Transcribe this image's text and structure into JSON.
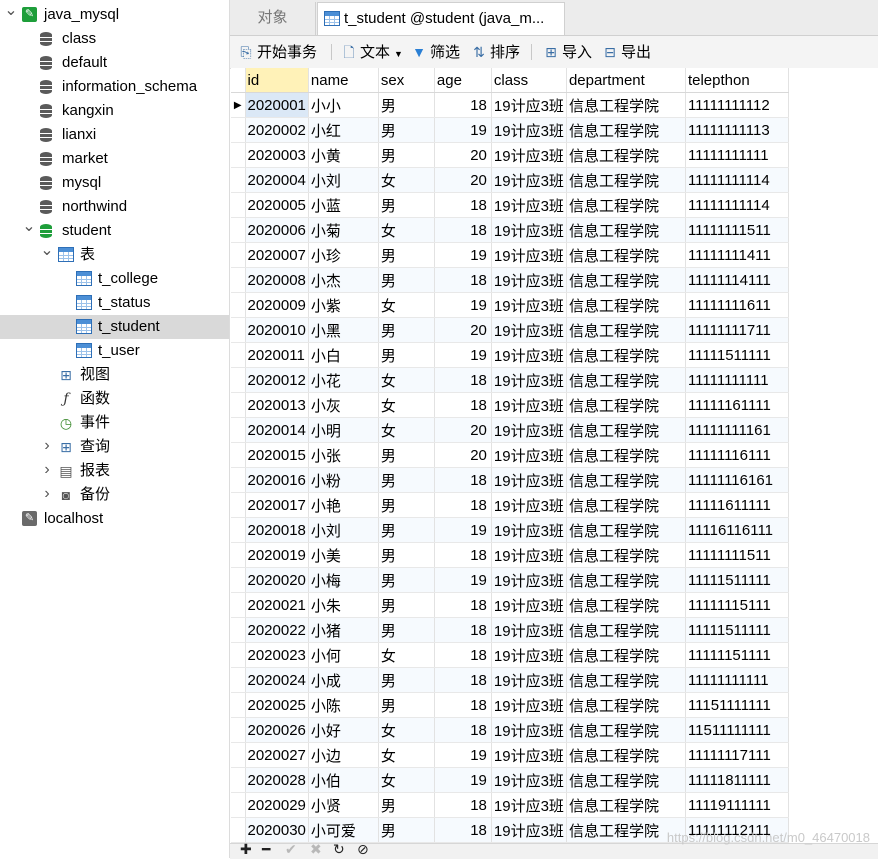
{
  "tree": {
    "items": [
      {
        "label": "java_mysql",
        "icon": "connection-icon",
        "arrow": "expanded",
        "level": 0,
        "selected": false
      },
      {
        "label": "class",
        "icon": "database-icon",
        "arrow": "",
        "level": 1,
        "selected": false
      },
      {
        "label": "default",
        "icon": "database-icon",
        "arrow": "",
        "level": 1,
        "selected": false
      },
      {
        "label": "information_schema",
        "icon": "database-icon",
        "arrow": "",
        "level": 1,
        "selected": false
      },
      {
        "label": "kangxin",
        "icon": "database-icon",
        "arrow": "",
        "level": 1,
        "selected": false
      },
      {
        "label": "lianxi",
        "icon": "database-icon",
        "arrow": "",
        "level": 1,
        "selected": false
      },
      {
        "label": "market",
        "icon": "database-icon",
        "arrow": "",
        "level": 1,
        "selected": false
      },
      {
        "label": "mysql",
        "icon": "database-icon",
        "arrow": "",
        "level": 1,
        "selected": false
      },
      {
        "label": "northwind",
        "icon": "database-icon",
        "arrow": "",
        "level": 1,
        "selected": false
      },
      {
        "label": "student",
        "icon": "database-open-icon",
        "arrow": "expanded",
        "level": 1,
        "selected": false
      },
      {
        "label": "表",
        "icon": "tables-folder-icon",
        "arrow": "expanded",
        "level": 2,
        "selected": false
      },
      {
        "label": "t_college",
        "icon": "table-icon",
        "arrow": "",
        "level": 3,
        "selected": false
      },
      {
        "label": "t_status",
        "icon": "table-icon",
        "arrow": "",
        "level": 3,
        "selected": false
      },
      {
        "label": "t_student",
        "icon": "table-icon",
        "arrow": "",
        "level": 3,
        "selected": true
      },
      {
        "label": "t_user",
        "icon": "table-icon",
        "arrow": "",
        "level": 3,
        "selected": false
      },
      {
        "label": "视图",
        "icon": "view-icon",
        "arrow": "",
        "level": 2,
        "selected": false
      },
      {
        "label": "函数",
        "icon": "function-icon",
        "arrow": "",
        "level": 2,
        "selected": false
      },
      {
        "label": "事件",
        "icon": "event-icon",
        "arrow": "",
        "level": 2,
        "selected": false
      },
      {
        "label": "查询",
        "icon": "query-icon",
        "arrow": "collapsed",
        "level": 2,
        "selected": false
      },
      {
        "label": "报表",
        "icon": "report-icon",
        "arrow": "collapsed",
        "level": 2,
        "selected": false
      },
      {
        "label": "备份",
        "icon": "backup-icon",
        "arrow": "collapsed",
        "level": 2,
        "selected": false
      },
      {
        "label": "localhost",
        "icon": "connection-grey-icon",
        "arrow": "",
        "level": 0,
        "selected": false
      }
    ]
  },
  "tabs": {
    "objects": "对象",
    "active": "t_student @student (java_m..."
  },
  "toolbar": {
    "begin_transaction": "开始事务",
    "text": "文本",
    "filter": "筛选",
    "sort": "排序",
    "import": "导入",
    "export": "导出"
  },
  "grid": {
    "columns": [
      "id",
      "name",
      "sex",
      "age",
      "class",
      "department",
      "telepthon"
    ],
    "rows": [
      [
        "2020001",
        "小小",
        "男",
        "18",
        "19计应3班",
        "信息工程学院",
        "11111111112"
      ],
      [
        "2020002",
        "小红",
        "男",
        "19",
        "19计应3班",
        "信息工程学院",
        "11111111113"
      ],
      [
        "2020003",
        "小黄",
        "男",
        "20",
        "19计应3班",
        "信息工程学院",
        "11111111111"
      ],
      [
        "2020004",
        "小刘",
        "女",
        "20",
        "19计应3班",
        "信息工程学院",
        "11111111114"
      ],
      [
        "2020005",
        "小蓝",
        "男",
        "18",
        "19计应3班",
        "信息工程学院",
        "11111111114"
      ],
      [
        "2020006",
        "小菊",
        "女",
        "18",
        "19计应3班",
        "信息工程学院",
        "11111111511"
      ],
      [
        "2020007",
        "小珍",
        "男",
        "19",
        "19计应3班",
        "信息工程学院",
        "11111111411"
      ],
      [
        "2020008",
        "小杰",
        "男",
        "18",
        "19计应3班",
        "信息工程学院",
        "11111114111"
      ],
      [
        "2020009",
        "小紫",
        "女",
        "19",
        "19计应3班",
        "信息工程学院",
        "11111111611"
      ],
      [
        "2020010",
        "小黑",
        "男",
        "20",
        "19计应3班",
        "信息工程学院",
        "11111111711"
      ],
      [
        "2020011",
        "小白",
        "男",
        "19",
        "19计应3班",
        "信息工程学院",
        "11111511111"
      ],
      [
        "2020012",
        "小花",
        "女",
        "18",
        "19计应3班",
        "信息工程学院",
        "11111111111"
      ],
      [
        "2020013",
        "小灰",
        "女",
        "18",
        "19计应3班",
        "信息工程学院",
        "11111161111"
      ],
      [
        "2020014",
        "小明",
        "女",
        "20",
        "19计应3班",
        "信息工程学院",
        "11111111161"
      ],
      [
        "2020015",
        "小张",
        "男",
        "20",
        "19计应3班",
        "信息工程学院",
        "11111116111"
      ],
      [
        "2020016",
        "小粉",
        "男",
        "18",
        "19计应3班",
        "信息工程学院",
        "11111116161"
      ],
      [
        "2020017",
        "小艳",
        "男",
        "18",
        "19计应3班",
        "信息工程学院",
        "11111611111"
      ],
      [
        "2020018",
        "小刘",
        "男",
        "19",
        "19计应3班",
        "信息工程学院",
        "11116116111"
      ],
      [
        "2020019",
        "小美",
        "男",
        "18",
        "19计应3班",
        "信息工程学院",
        "11111111511"
      ],
      [
        "2020020",
        "小梅",
        "男",
        "19",
        "19计应3班",
        "信息工程学院",
        "11111511111"
      ],
      [
        "2020021",
        "小朱",
        "男",
        "18",
        "19计应3班",
        "信息工程学院",
        "11111115111"
      ],
      [
        "2020022",
        "小猪",
        "男",
        "18",
        "19计应3班",
        "信息工程学院",
        "11111511111"
      ],
      [
        "2020023",
        "小何",
        "女",
        "18",
        "19计应3班",
        "信息工程学院",
        "11111151111"
      ],
      [
        "2020024",
        "小成",
        "男",
        "18",
        "19计应3班",
        "信息工程学院",
        "11111111111"
      ],
      [
        "2020025",
        "小陈",
        "男",
        "18",
        "19计应3班",
        "信息工程学院",
        "11151111111"
      ],
      [
        "2020026",
        "小好",
        "女",
        "18",
        "19计应3班",
        "信息工程学院",
        "11511111111"
      ],
      [
        "2020027",
        "小边",
        "女",
        "19",
        "19计应3班",
        "信息工程学院",
        "11111117111"
      ],
      [
        "2020028",
        "小伯",
        "女",
        "19",
        "19计应3班",
        "信息工程学院",
        "11111811111"
      ],
      [
        "2020029",
        "小贤",
        "男",
        "18",
        "19计应3班",
        "信息工程学院",
        "11119111111"
      ],
      [
        "2020030",
        "小可爱",
        "男",
        "18",
        "19计应3班",
        "信息工程学院",
        "11111112111"
      ]
    ]
  },
  "watermark": "https://blog.csdn.net/m0_46470018"
}
